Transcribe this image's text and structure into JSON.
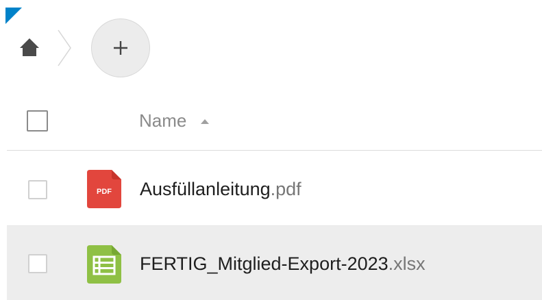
{
  "colors": {
    "brand": "#0082c9",
    "pdf_icon": "#e2463d",
    "spreadsheet_icon": "#8fc045",
    "selected_row_bg": "#ededed"
  },
  "breadcrumb": {
    "home_icon": "home-icon",
    "new_button_icon": "plus-icon"
  },
  "file_list": {
    "header": {
      "name_label": "Name",
      "sort_icon": "sort-ascending-icon"
    },
    "files": [
      {
        "base_name": "Ausfüllanleitung",
        "extension": ".pdf",
        "icon": "pdf-file-icon"
      },
      {
        "base_name": "FERTIG_Mitglied-Export-2023",
        "extension": ".xlsx",
        "icon": "spreadsheet-file-icon"
      }
    ]
  }
}
